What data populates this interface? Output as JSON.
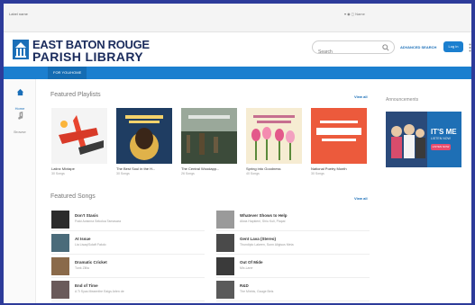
{
  "os_bar": {
    "left_text": "Label name",
    "right_text": "▾ ◉ ◻ Name"
  },
  "header": {
    "logo_line1": "EAST BATON ROUGE",
    "logo_line2": "PARISH LIBRARY",
    "search_placeholder": "Search",
    "advanced_search": "ADVANCED SEARCH",
    "login_label": "Log in"
  },
  "nav": {
    "tab_label": "FOR YOU/HOME"
  },
  "rail": {
    "items": [
      {
        "label": "Home"
      },
      {
        "label": "Browse"
      }
    ]
  },
  "playlists": {
    "title": "Featured Playlists",
    "view_all": "View all",
    "items": [
      {
        "title": "Latinx Mixtape",
        "count": "30 Songs"
      },
      {
        "title": "The Best Soul in the H...",
        "count": "30 Songs"
      },
      {
        "title": "The Central Woodapp...",
        "count": "26 Songs"
      },
      {
        "title": "Spring into Goodness",
        "count": "40 Songs"
      },
      {
        "title": "National Poetry Month",
        "count": "30 Songs"
      }
    ]
  },
  "songs": {
    "title": "Featured Songs",
    "view_all": "View all",
    "left": [
      {
        "name": "Don't Stasis",
        "artist": "Fraki Avianna Sekoloa Tamasara"
      },
      {
        "name": "At Issue",
        "artist": "Lia Lisaq/Solaft Fakdo"
      },
      {
        "name": "Dramatic Cricket",
        "artist": "Tunk Zillia"
      },
      {
        "name": "End of Time",
        "artist": "A Ti Syas Meaenthe Eaigs Arlen de"
      }
    ],
    "right": [
      {
        "name": "Whatever Shows to Help",
        "artist": "Alicia Hapkieni, Shiu Kuli, Piapal"
      },
      {
        "name": "Gent Lava (Stereo)",
        "artist": "Thundiplo Lakeen, Sunn Aligisus Meta"
      },
      {
        "name": "Out Of Mide",
        "artist": "Mix-Lane"
      },
      {
        "name": "R&D",
        "artist": "The Minhis, Gauge Beis"
      }
    ]
  },
  "announcements": {
    "title": "Announcements",
    "banner_title": "IT'S ME",
    "banner_sub": "LISTEN NOW",
    "banner_button": "LISTEN NOW"
  },
  "colors": {
    "brand_blue": "#1b7fcf",
    "frame": "#2d3b9a",
    "logo_navy": "#1a2b5c"
  }
}
